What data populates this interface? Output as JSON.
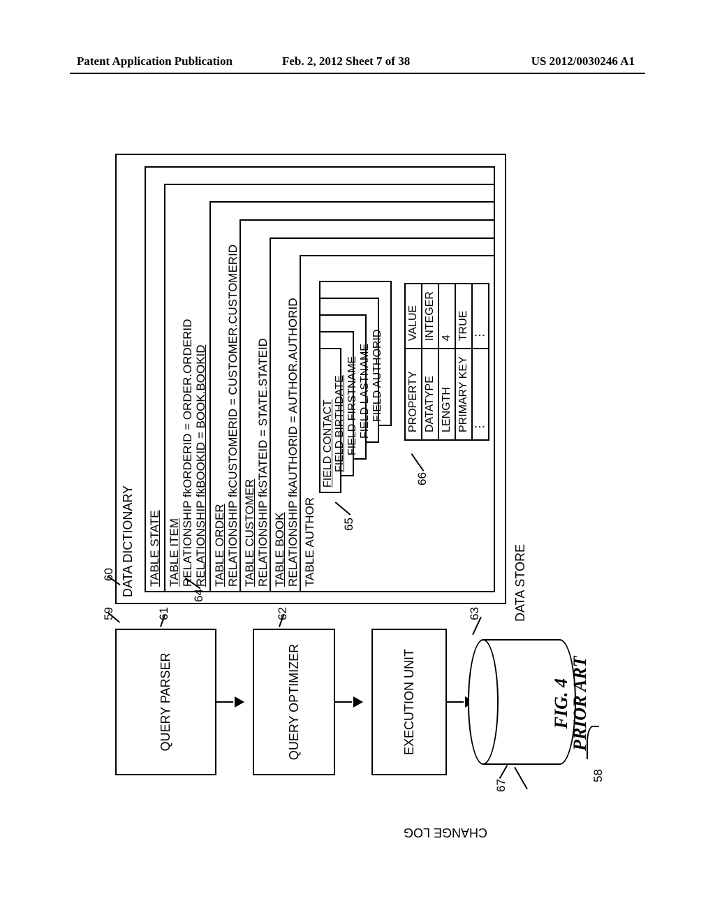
{
  "header": {
    "left": "Patent Application Publication",
    "center": "Feb. 2, 2012  Sheet 7 of 38",
    "right": "US 2012/0030246 A1"
  },
  "pipeline": {
    "box1": "QUERY PARSER",
    "box2": "QUERY OPTIMIZER",
    "box3": "EXECUTION UNIT",
    "datastore": "DATA STORE",
    "changelog": "CHANGE LOG"
  },
  "dict": {
    "title": "DATA DICTIONARY",
    "state": {
      "label": "TABLE STATE"
    },
    "item": {
      "label": "TABLE ITEM",
      "rel1": "RELATIONSHIP fkORDERID = ORDER.ORDERID",
      "rel2": "RELATIONSHIP fkBOOKID = BOOK.BOOKID"
    },
    "order": {
      "label": "TABLE ORDER",
      "rel1": "RELATIONSHIP fkCUSTOMERID = CUSTOMER.CUSTOMERID"
    },
    "customer": {
      "label": "TABLE CUSTOMER",
      "rel1": "RELATIONSHIP fkSTATEID = STATE.STATEID"
    },
    "book": {
      "label": "TABLE BOOK",
      "rel1": "RELATIONSHIP fkAUTHORID = AUTHOR.AUTHORID"
    },
    "author": {
      "label": "TABLE AUTHOR",
      "fields": {
        "f1": "FIELD CONTACT",
        "f2": "FIELD BIRTHDATE",
        "f3": "FIELD FIRSTNAME",
        "f4": "FIELD LASTNAME",
        "f5": "FIELD AUTHORID"
      },
      "props": {
        "h1": "PROPERTY",
        "h2": "VALUE",
        "r1a": "DATATYPE",
        "r1b": "INTEGER",
        "r2a": "LENGTH",
        "r2b": "4",
        "r3a": "PRIMARY KEY",
        "r3b": "TRUE",
        "r4a": "⋮",
        "r4b": "⋮"
      }
    }
  },
  "refs": {
    "n58": "58",
    "n59": "59",
    "n60": "60",
    "n61": "61",
    "n62": "62",
    "n63": "63",
    "n64": "64",
    "n65": "65",
    "n66": "66",
    "n67": "67"
  },
  "figure": {
    "line1": "FIG. 4",
    "line2": "PRIOR ART"
  }
}
